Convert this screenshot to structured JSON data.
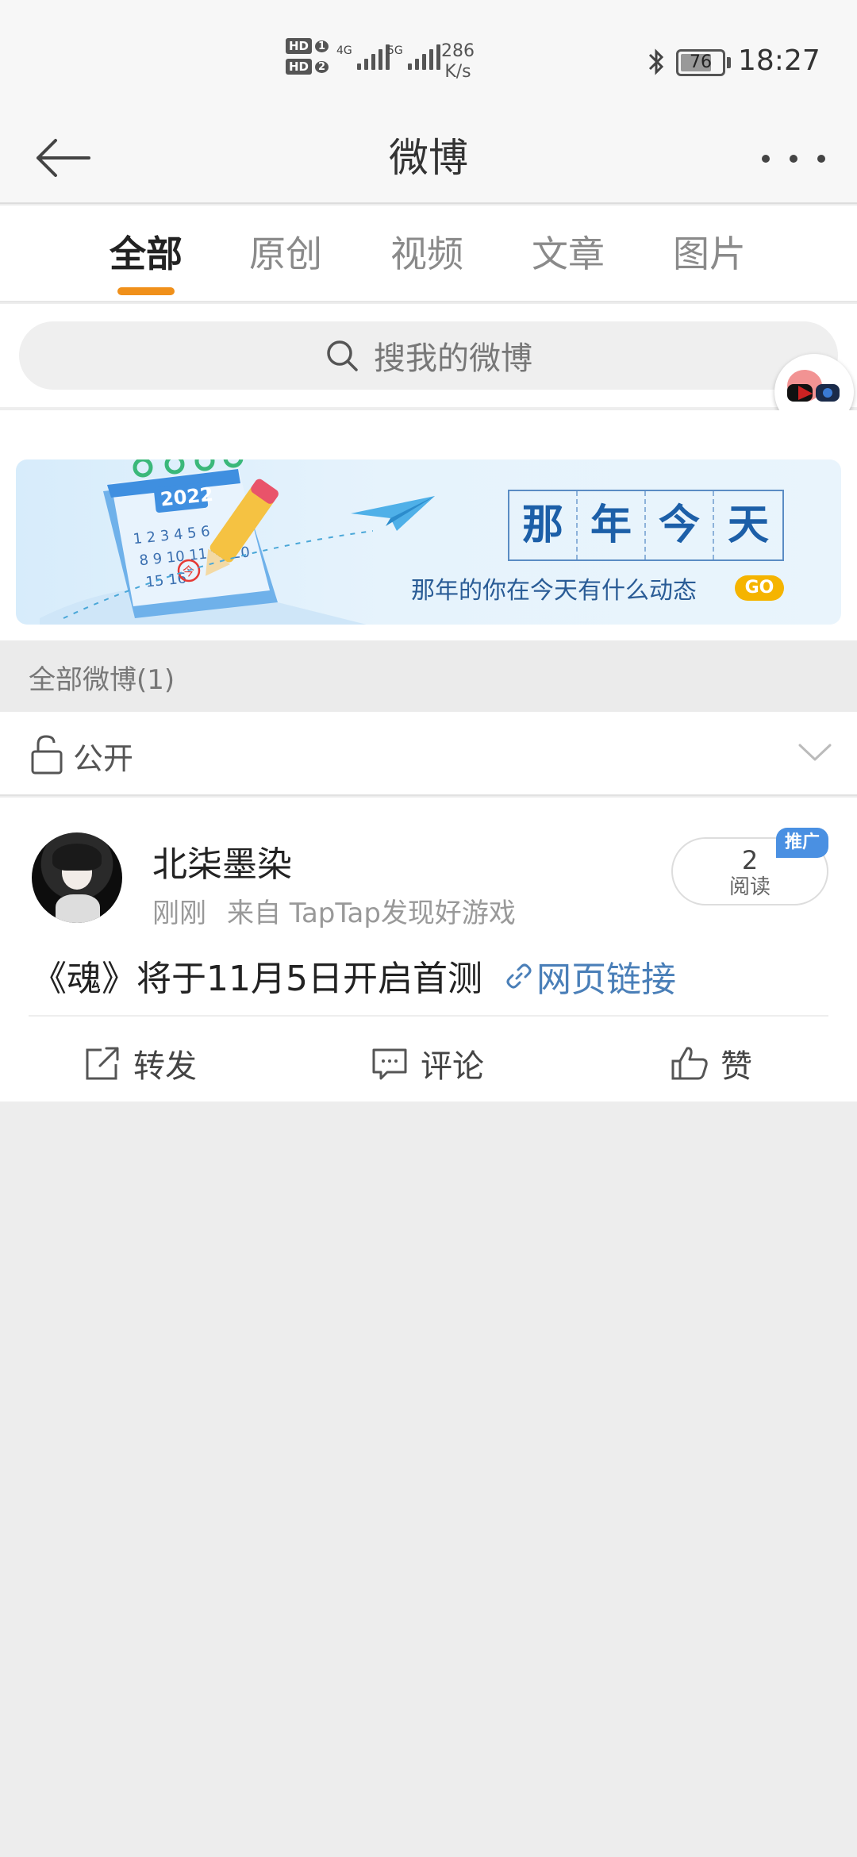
{
  "status_bar": {
    "hd1": "HD",
    "hd1_num": "1",
    "hd2": "HD",
    "hd2_num": "2",
    "net1": "4G",
    "net2": "5G",
    "speed_value": "286",
    "speed_unit": "K/s",
    "battery": "76",
    "battery_level": 0.76,
    "time": "18:27"
  },
  "nav": {
    "title": "微博",
    "back_icon": "arrow-left-icon",
    "more_icon": "more-dots-icon"
  },
  "tabs": [
    {
      "label": "全部",
      "active": true
    },
    {
      "label": "原创",
      "active": false
    },
    {
      "label": "视频",
      "active": false
    },
    {
      "label": "文章",
      "active": false
    },
    {
      "label": "图片",
      "active": false
    }
  ],
  "search": {
    "placeholder": "搜我的微博",
    "icon": "search-icon"
  },
  "banner": {
    "title_chars": [
      "那",
      "年",
      "今",
      "天"
    ],
    "subtitle": "那年的你在今天有什么动态",
    "go_label": "GO",
    "calendar_year": "2022",
    "calendar_days": "1 2 3 4 5 6",
    "calendar_days2": "8 9 10 11 12",
    "calendar_days3": "15 16",
    "calendar_days4": "19 20",
    "calendar_today": "今"
  },
  "section": {
    "header": "全部微博(1)"
  },
  "privacy": {
    "label": "公开",
    "lock_icon": "unlock-icon",
    "chevron_icon": "chevron-down-icon"
  },
  "post": {
    "username": "北柒墨染",
    "time": "刚刚",
    "source": "来自 TapTap发现好游戏",
    "read_count": "2",
    "read_label": "阅读",
    "promo_tag": "推广",
    "text": "《魂》将于11月5日开启首测",
    "link_label": "网页链接",
    "actions": {
      "repost": "转发",
      "comment": "评论",
      "like": "赞"
    }
  },
  "colors": {
    "accent": "#f0901a",
    "link": "#4a7fb8",
    "promo": "#4a90e2",
    "background": "#ededed"
  }
}
